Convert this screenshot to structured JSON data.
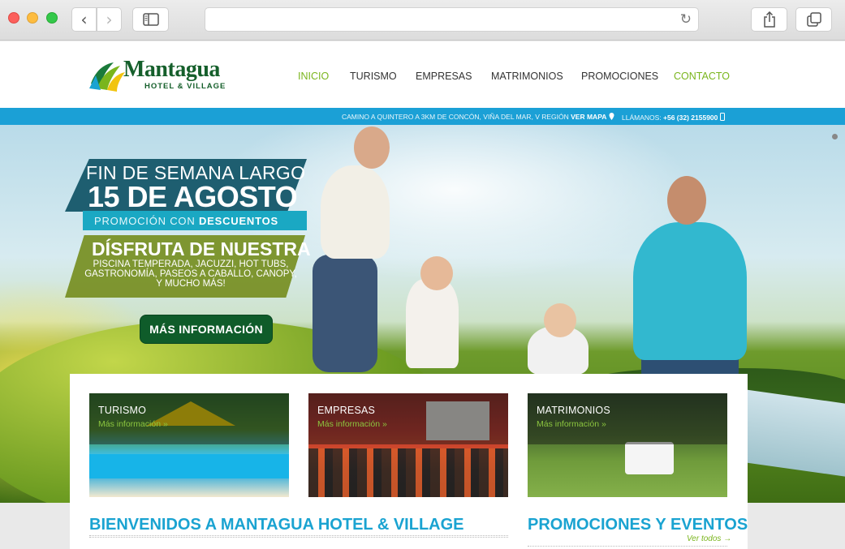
{
  "browser": {
    "back_icon": "‹",
    "forward_icon": "›",
    "reload_icon": "↻"
  },
  "site": {
    "logo_name": "Mantagua",
    "logo_sub": "HOTEL & VILLAGE"
  },
  "nav": {
    "items": [
      {
        "label": "INICIO"
      },
      {
        "label": "TURISMO"
      },
      {
        "label": "EMPRESAS"
      },
      {
        "label": "MATRIMONIOS"
      },
      {
        "label": "PROMOCIONES"
      },
      {
        "label": "CONTACTO"
      }
    ],
    "active_color": "#7ab51d"
  },
  "infobar": {
    "address": "CAMINO A QUINTERO A 3KM DE CONCÓN, VIÑA DEL MAR, V REGIÓN",
    "map_link": "VER MAPA",
    "phone_label": "LLÁMANOS:",
    "phone": "+56 (32) 2155900",
    "color": "#1ba0d6"
  },
  "hero": {
    "line1": "FIN DE SEMANA LARGO",
    "line2": "15 DE AGOSTO",
    "line3_a": "PROMOCIÓN CON",
    "line3_b": "DESCUENTOS",
    "line4": "DÍSFRUTA DE NUESTRA",
    "line5": "PISCINA TEMPERADA, JACUZZI, HOT TUBS, GASTRONOMÍA, PASEOS A CABALLO, CANOPY, Y MUCHO MÁS!",
    "cta": "MÁS INFORMACIÓN"
  },
  "tiles": [
    {
      "label": "TURISMO",
      "more": "Más información »"
    },
    {
      "label": "EMPRESAS",
      "more": "Más información »"
    },
    {
      "label": "MATRIMONIOS",
      "more": "Más información »"
    }
  ],
  "sections": {
    "welcome_title": "BIENVENIDOS A MANTAGUA HOTEL & VILLAGE",
    "promos_title": "PROMOCIONES Y EVENTOS",
    "ver_todos": "Ver todos →"
  }
}
